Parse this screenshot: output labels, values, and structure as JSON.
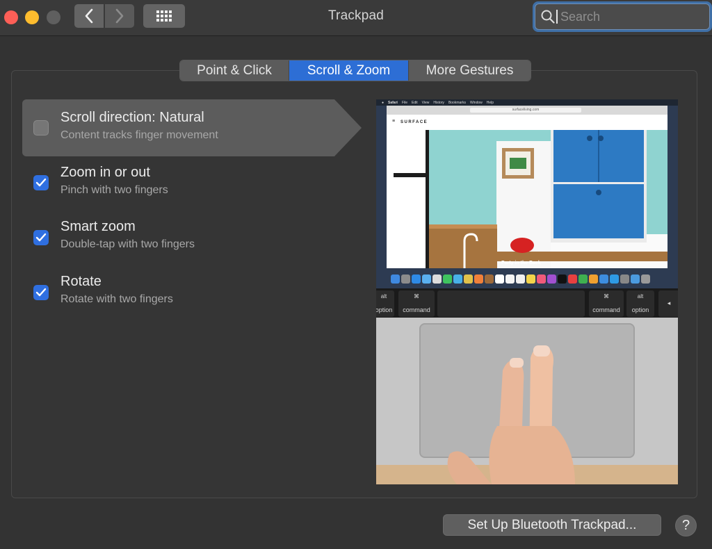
{
  "window": {
    "title": "Trackpad",
    "search_placeholder": "Search",
    "traffic_colors": {
      "close": "#fe5f57",
      "minimize": "#febc2e",
      "maximize": "#5f5f5f"
    }
  },
  "toolbar": {
    "back_icon": "chevron-left-icon",
    "forward_icon": "chevron-right-icon",
    "show_all_icon": "grid-icon"
  },
  "tabs": [
    {
      "label": "Point & Click",
      "active": false
    },
    {
      "label": "Scroll & Zoom",
      "active": true
    },
    {
      "label": "More Gestures",
      "active": false
    }
  ],
  "options": [
    {
      "title": "Scroll direction: Natural",
      "subtitle": "Content tracks finger movement",
      "checked": false,
      "selected": true
    },
    {
      "title": "Zoom in or out",
      "subtitle": "Pinch with two fingers",
      "checked": true,
      "selected": false
    },
    {
      "title": "Smart zoom",
      "subtitle": "Double-tap with two fingers",
      "checked": true,
      "selected": false
    },
    {
      "title": "Rotate",
      "subtitle": "Rotate with two fingers",
      "checked": true,
      "selected": false
    }
  ],
  "preview": {
    "menubar_items": [
      "Safari",
      "File",
      "Edit",
      "View",
      "History",
      "Bookmarks",
      "Window",
      "Help"
    ],
    "url": "surfaceliving.com",
    "site_brand": "SURFACE",
    "caption": "Party in the Back",
    "keys": [
      {
        "top": "alt",
        "bottom": "option"
      },
      {
        "top": "⌘",
        "bottom": "command"
      },
      {
        "top": "⌘",
        "bottom": "command"
      },
      {
        "top": "alt",
        "bottom": "option"
      },
      {
        "top": "",
        "bottom": "◂"
      }
    ]
  },
  "footer": {
    "setup_button": "Set Up Bluetooth Trackpad...",
    "help_button": "?"
  },
  "colors": {
    "accent": "#2d6ed5",
    "checkbox_on": "#2f6fe0",
    "background": "#333333"
  }
}
